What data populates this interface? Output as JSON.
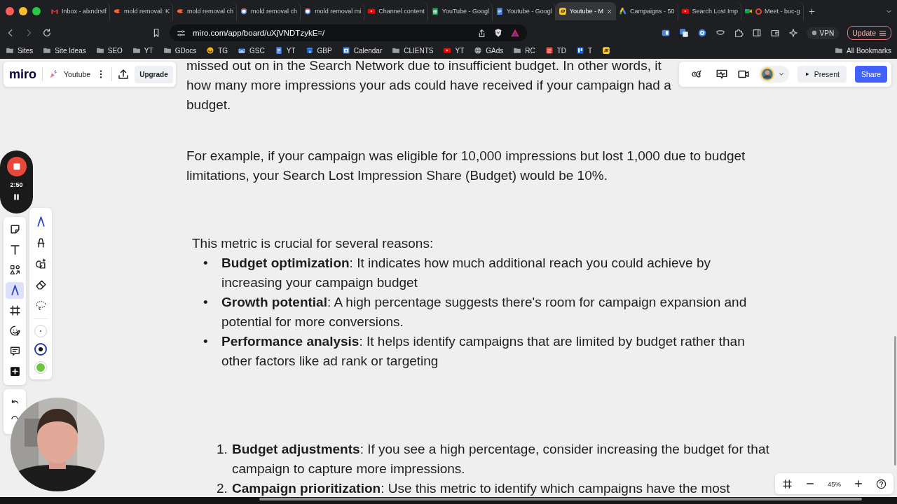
{
  "browser": {
    "tabs": [
      {
        "label": "Inbox - alxndrstf",
        "kind": "mail",
        "selected": false,
        "recording": false
      },
      {
        "label": "mold removal: K",
        "kind": "flame",
        "selected": false,
        "recording": false
      },
      {
        "label": "mold removal ch",
        "kind": "flame",
        "selected": false,
        "recording": false
      },
      {
        "label": "mold removal ch",
        "kind": "google",
        "selected": false,
        "recording": false
      },
      {
        "label": "mold removal mi",
        "kind": "google",
        "selected": false,
        "recording": false
      },
      {
        "label": "Channel content",
        "kind": "youtube",
        "selected": false,
        "recording": false
      },
      {
        "label": "YouTube - Googl",
        "kind": "sheets",
        "selected": false,
        "recording": false
      },
      {
        "label": "Youtube - Googl",
        "kind": "docs",
        "selected": false,
        "recording": false
      },
      {
        "label": "Youtube - M",
        "kind": "miro",
        "selected": true,
        "recording": false
      },
      {
        "label": "Campaigns - 50",
        "kind": "ads",
        "selected": false,
        "recording": false
      },
      {
        "label": "Search Lost Imp",
        "kind": "youtube",
        "selected": false,
        "recording": false
      },
      {
        "label": "Meet - buc-g",
        "kind": "meet",
        "selected": false,
        "recording": true
      }
    ],
    "address": "miro.com/app/board/uXjVNDTzykE=/",
    "vpn": "VPN",
    "update": "Update",
    "bookmarks": [
      {
        "label": "Sites",
        "kind": "folder"
      },
      {
        "label": "Site Ideas",
        "kind": "folder"
      },
      {
        "label": "SEO",
        "kind": "folder"
      },
      {
        "label": "YT",
        "kind": "folder"
      },
      {
        "label": "GDocs",
        "kind": "folder"
      },
      {
        "label": "TG",
        "kind": "smiley"
      },
      {
        "label": "GSC",
        "kind": "gsc"
      },
      {
        "label": "YT",
        "kind": "docs"
      },
      {
        "label": "GBP",
        "kind": "gbp"
      },
      {
        "label": "Calendar",
        "kind": "calendar"
      },
      {
        "label": "CLIENTS",
        "kind": "folder"
      },
      {
        "label": "YT",
        "kind": "youtube"
      },
      {
        "label": "GAds",
        "kind": "globe"
      },
      {
        "label": "RC",
        "kind": "folder"
      },
      {
        "label": "TD",
        "kind": "todoist"
      },
      {
        "label": "T",
        "kind": "trello"
      },
      {
        "kind": "miro"
      }
    ],
    "all_bookmarks": "All Bookmarks"
  },
  "board_toolbar": {
    "logo": "miro",
    "board_name": "Youtube",
    "upgrade": "Upgrade"
  },
  "collab_toolbar": {
    "present": "Present",
    "share": "Share"
  },
  "recording": {
    "time": "2:50"
  },
  "tools": [
    {
      "kind": "sticky",
      "selected": false
    },
    {
      "kind": "text",
      "selected": false
    },
    {
      "kind": "shapes",
      "selected": false
    },
    {
      "kind": "pen",
      "selected": true
    },
    {
      "kind": "frame",
      "selected": false
    },
    {
      "kind": "sticker",
      "selected": false
    },
    {
      "kind": "comment",
      "selected": false
    },
    {
      "kind": "more",
      "selected": false
    }
  ],
  "pen_tools": [
    {
      "kind": "pen",
      "selected": true
    },
    {
      "kind": "highlighter",
      "selected": false
    },
    {
      "kind": "smart",
      "selected": false
    },
    {
      "kind": "eraser",
      "selected": false
    },
    {
      "kind": "lasso",
      "selected": false
    }
  ],
  "stroke_options": [
    {
      "kind": "thin",
      "selected": false
    },
    {
      "kind": "thick",
      "selected": true
    },
    {
      "kind": "color",
      "color": "#6cc644",
      "selected": false
    }
  ],
  "document": {
    "fragment_lines": [
      "missed out on in the Search Network due to insufficient budget. In other words, it",
      "how many more impressions your ads could have received if your campaign had a",
      "budget."
    ],
    "example": "For example, if your campaign was eligible for 10,000 impressions but lost 1,000 due to budget limitations, your Search Lost Impression Share (Budget) would be 10%.",
    "reasons_intro": "This metric is crucial for several reasons:",
    "reasons": [
      {
        "marker": "•",
        "text": "**Budget optimization**: It indicates how much additional reach you could achieve by increasing your campaign budget"
      },
      {
        "marker": "•",
        "text": "**Growth potential**: A high percentage suggests there's room for campaign expansion and potential for more conversions."
      },
      {
        "marker": "•",
        "text": "**Performance analysis**: It helps identify campaigns that are limited by budget rather than other factors like ad rank or targeting"
      }
    ],
    "actions": [
      {
        "number": "1.",
        "text": "**Budget adjustments**: If you see a high percentage, consider increasing the budget for that campaign to capture more impressions."
      },
      {
        "number": "2.",
        "text": "**Campaign prioritization**: Use this metric to identify which campaigns have the most"
      }
    ]
  },
  "zoom": {
    "level_label": "45%"
  }
}
